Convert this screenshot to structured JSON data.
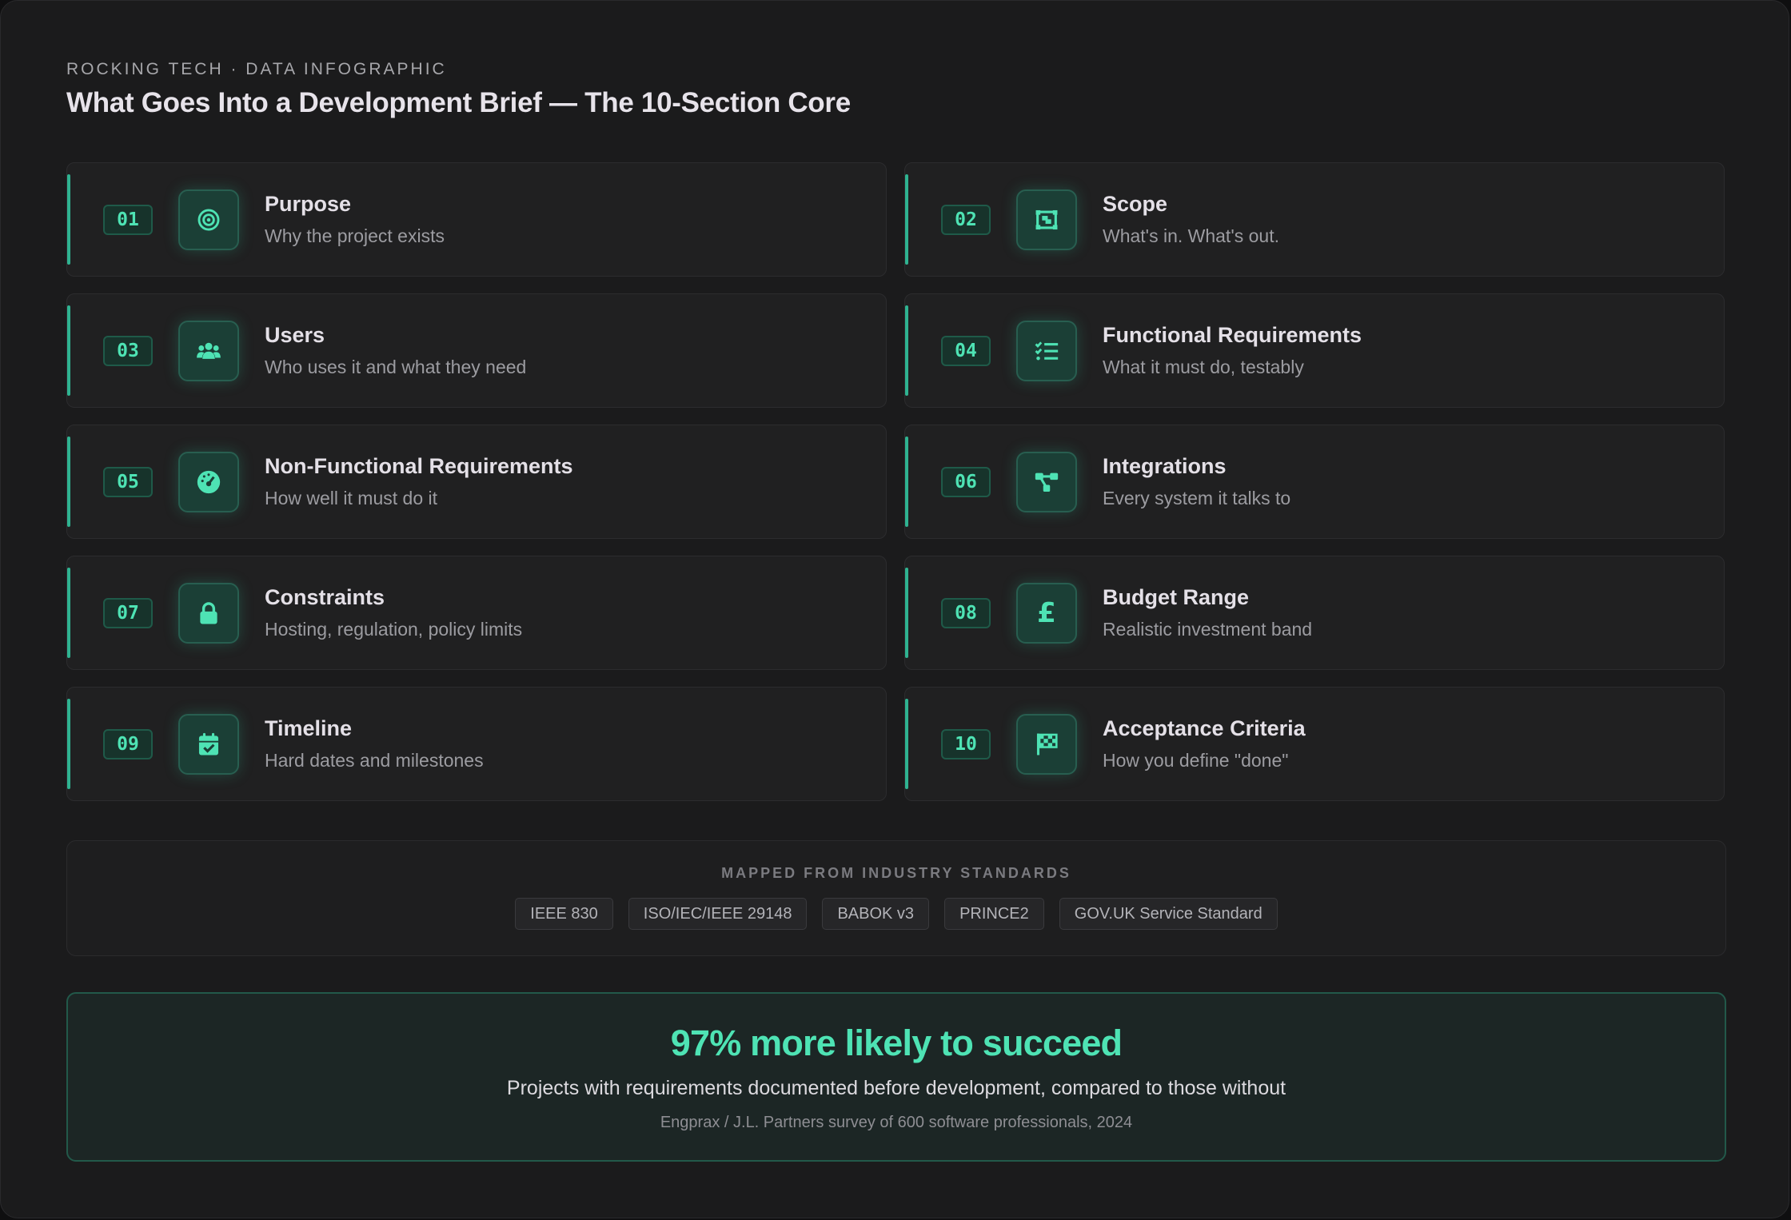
{
  "header": {
    "eyebrow": "ROCKING TECH · DATA INFOGRAPHIC",
    "title": "What Goes Into a Development Brief — The 10-Section Core"
  },
  "sections": [
    {
      "number": "01",
      "icon": "target-icon",
      "title": "Purpose",
      "subtitle": "Why the project exists"
    },
    {
      "number": "02",
      "icon": "scope-frame-icon",
      "title": "Scope",
      "subtitle": "What's in. What's out."
    },
    {
      "number": "03",
      "icon": "users-icon",
      "title": "Users",
      "subtitle": "Who uses it and what they need"
    },
    {
      "number": "04",
      "icon": "checklist-icon",
      "title": "Functional Requirements",
      "subtitle": "What it must do, testably"
    },
    {
      "number": "05",
      "icon": "gauge-icon",
      "title": "Non-Functional Requirements",
      "subtitle": "How well it must do it"
    },
    {
      "number": "06",
      "icon": "integration-nodes-icon",
      "title": "Integrations",
      "subtitle": "Every system it talks to"
    },
    {
      "number": "07",
      "icon": "lock-icon",
      "title": "Constraints",
      "subtitle": "Hosting, regulation, policy limits"
    },
    {
      "number": "08",
      "icon": "pound-icon",
      "title": "Budget Range",
      "subtitle": "Realistic investment band"
    },
    {
      "number": "09",
      "icon": "calendar-check-icon",
      "title": "Timeline",
      "subtitle": "Hard dates and milestones"
    },
    {
      "number": "10",
      "icon": "checkered-flag-icon",
      "title": "Acceptance Criteria",
      "subtitle": "How you define \"done\""
    }
  ],
  "standards": {
    "label": "MAPPED FROM INDUSTRY STANDARDS",
    "items": [
      "IEEE 830",
      "ISO/IEC/IEEE 29148",
      "BABOK v3",
      "PRINCE2",
      "GOV.UK Service Standard"
    ]
  },
  "stat": {
    "headline": "97% more likely to succeed",
    "body": "Projects with requirements documented before development, compared to those without",
    "source": "Engprax / J.L. Partners survey of 600 software professionals, 2024"
  },
  "colors": {
    "accent": "#4ee3b4",
    "background": "#1b1b1c",
    "card": "#202021"
  }
}
